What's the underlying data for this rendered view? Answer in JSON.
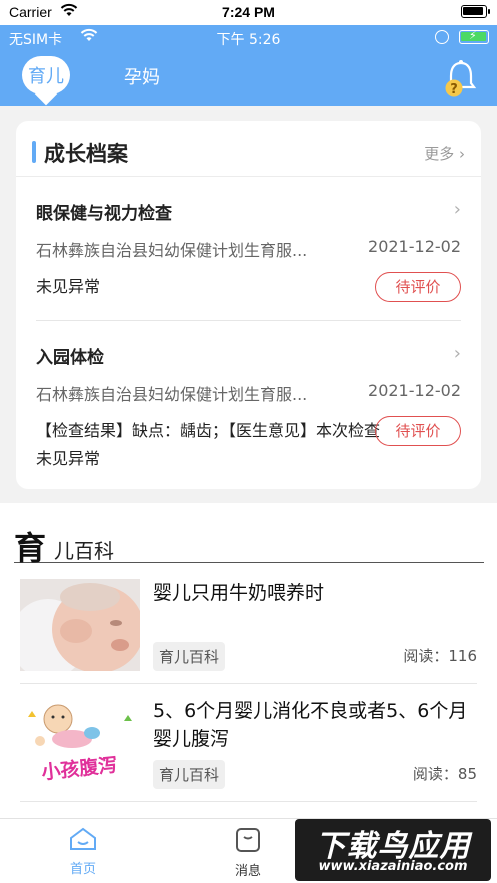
{
  "outer_status": {
    "carrier": "Carrier",
    "time": "7:24 PM"
  },
  "inner_status": {
    "carrier": "无SIM卡",
    "time": "下午 5:26"
  },
  "top_nav": {
    "active_tab": "育儿",
    "inactive_tab": "孕妈"
  },
  "growth": {
    "title": "成长档案",
    "more_label": "更多",
    "records": [
      {
        "title": "眼保健与视力检查",
        "hospital": "石林彝族自治县妇幼保健计划生育服...",
        "date": "2021-12-02",
        "result": "未见异常",
        "rate_label": "待评价"
      },
      {
        "title": "入园体检",
        "hospital": "石林彝族自治县妇幼保健计划生育服...",
        "date": "2021-12-02",
        "result": "【检查结果】缺点：龋齿；【医生意见】本次检查未见异常",
        "rate_label": "待评价"
      }
    ]
  },
  "wiki": {
    "head_big": "育",
    "head_small": "儿百科",
    "articles": [
      {
        "title": "婴儿只用牛奶喂养时",
        "tag": "育儿百科",
        "read_label": "阅读：116"
      },
      {
        "title": "5、6个月婴儿消化不良或者5、6个月婴儿腹泻",
        "tag": "育儿百科",
        "read_label": "阅读：85",
        "thumb_text": "小孩腹泻"
      }
    ]
  },
  "tabbar": {
    "home": "首页",
    "messages": "消息"
  },
  "watermark": {
    "line1": "下载鸟应用",
    "line2": "www.xiazainiao.com"
  },
  "colors": {
    "accent": "#62aaf5",
    "rate_border": "#e05050",
    "tab_active": "#62aaf5"
  }
}
